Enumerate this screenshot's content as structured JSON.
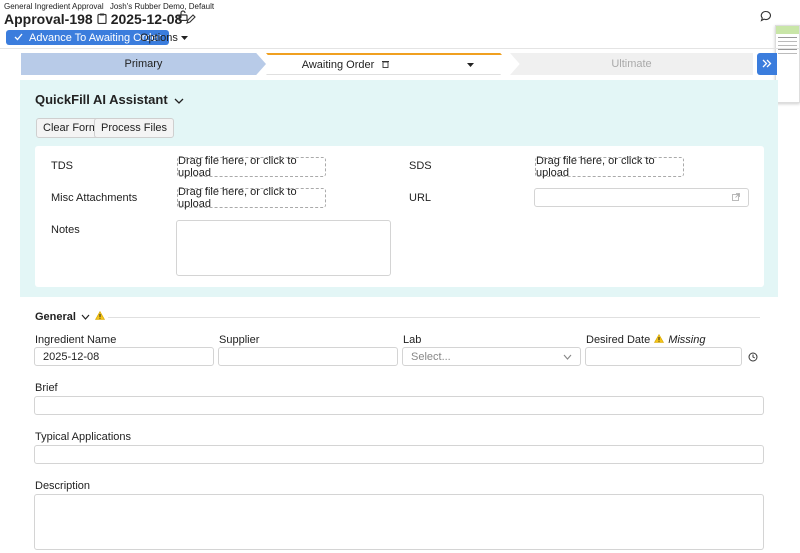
{
  "header": {
    "breadcrumb": "General Ingredient Approval",
    "org": "Josh's Rubber Demo, Default",
    "record_id": "Approval-198",
    "date": "2025-12-08"
  },
  "toolbar": {
    "advance_label": "Advance To Awaiting Order",
    "options_label": "Options"
  },
  "stages": {
    "primary": "Primary",
    "awaiting": "Awaiting Order",
    "ultimate": "Ultimate"
  },
  "quickfill": {
    "title": "QuickFill AI Assistant",
    "clear_label": "Clear Form",
    "process_label": "Process Files",
    "tds_label": "TDS",
    "sds_label": "SDS",
    "misc_label": "Misc Attachments",
    "url_label": "URL",
    "notes_label": "Notes",
    "upload_text": "Drag file here, or click to upload"
  },
  "general": {
    "title": "General",
    "ingredient_label": "Ingredient Name",
    "ingredient_value": "2025-12-08",
    "supplier_label": "Supplier",
    "lab_label": "Lab",
    "lab_placeholder": "Select...",
    "desired_label": "Desired Date",
    "missing_label": "Missing",
    "brief_label": "Brief",
    "typical_label": "Typical Applications",
    "description_label": "Description"
  },
  "colors": {
    "accent": "#3b7ddd",
    "quickfill_bg": "#e3f6f6",
    "stage_done": "#b8cbe8",
    "stage_active_border": "#f0a020",
    "warning": "#f5c518"
  }
}
